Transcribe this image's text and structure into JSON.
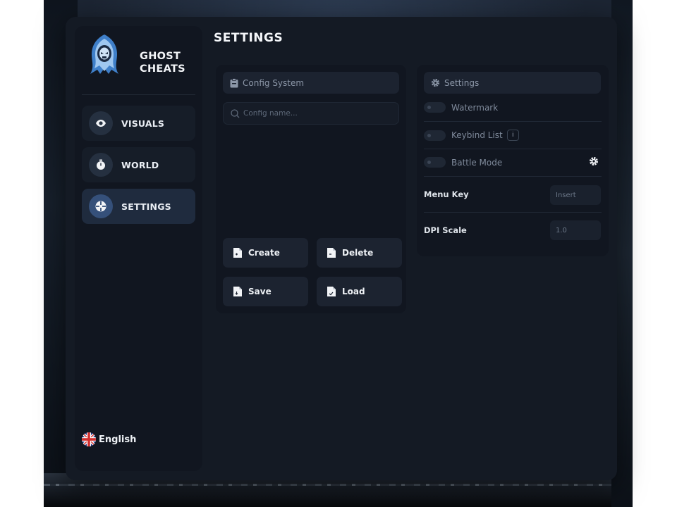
{
  "brand": {
    "name": "GHOST\nCHEATS"
  },
  "sidebar": {
    "items": [
      {
        "label": "VISUALS",
        "icon": "eye-icon",
        "active": false
      },
      {
        "label": "WORLD",
        "icon": "stopwatch-icon",
        "active": false
      },
      {
        "label": "SETTINGS",
        "icon": "crosshair-icon",
        "active": true
      }
    ],
    "language": {
      "label": "English",
      "icon": "uk-flag-icon"
    }
  },
  "page": {
    "title": "SETTINGS"
  },
  "config_panel": {
    "header": "Config System",
    "header_icon": "clipboard-icon",
    "search_placeholder": "Config name...",
    "buttons": [
      {
        "label": "Create",
        "icon": "file-icon"
      },
      {
        "label": "Delete",
        "icon": "file-icon"
      },
      {
        "label": "Save",
        "icon": "file-icon"
      },
      {
        "label": "Load",
        "icon": "file-icon"
      }
    ]
  },
  "settings_panel": {
    "header": "Settings",
    "header_icon": "gear-icon",
    "toggles": [
      {
        "label": "Watermark",
        "enabled": false
      },
      {
        "label": "Keybind List",
        "enabled": false,
        "badge": "i"
      },
      {
        "label": "Battle Mode",
        "enabled": false,
        "action_icon": "gear-icon"
      }
    ],
    "fields": [
      {
        "label": "Menu Key",
        "value": "Insert"
      },
      {
        "label": "DPI Scale",
        "value": "1.0"
      }
    ]
  },
  "colors": {
    "window_bg": "#141a24",
    "panel_bg": "#111620",
    "active_nav": "#1f2b3e",
    "accent": "#35507a",
    "text_primary": "#eef1f5",
    "text_muted": "#7f8a9b"
  }
}
